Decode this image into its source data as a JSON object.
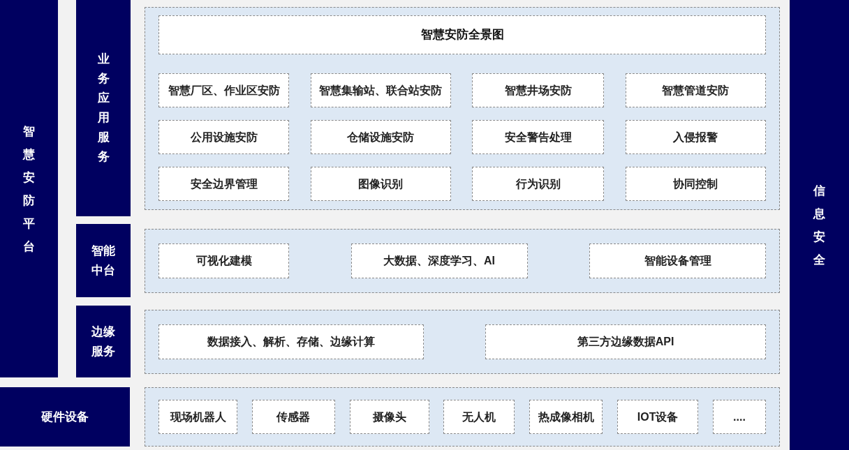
{
  "platform_label": "智慧安防平台",
  "security_label": "信息安全",
  "layers": [
    {
      "label": "业务应用服务",
      "kind": "vertical",
      "title": "智慧安防全景图",
      "items": [
        "智慧厂区、作业区安防",
        "智慧集输站、联合站安防",
        "智慧井场安防",
        "智慧管道安防",
        "公用设施安防",
        "仓储设施安防",
        "安全警告处理",
        "入侵报警",
        "安全边界管理",
        "图像识别",
        "行为识别",
        "协同控制"
      ]
    },
    {
      "label": "智能中台",
      "kind": "stacked",
      "items": [
        "可视化建模",
        "大数据、深度学习、AI",
        "智能设备管理"
      ]
    },
    {
      "label": "边缘服务",
      "kind": "stacked",
      "items": [
        "数据接入、解析、存储、边缘计算",
        "第三方边缘数据API"
      ]
    }
  ],
  "hardware": {
    "label": "硬件设备",
    "items": [
      "现场机器人",
      "传感器",
      "摄像头",
      "无人机",
      "热成像相机",
      "IOT设备",
      "...."
    ]
  }
}
